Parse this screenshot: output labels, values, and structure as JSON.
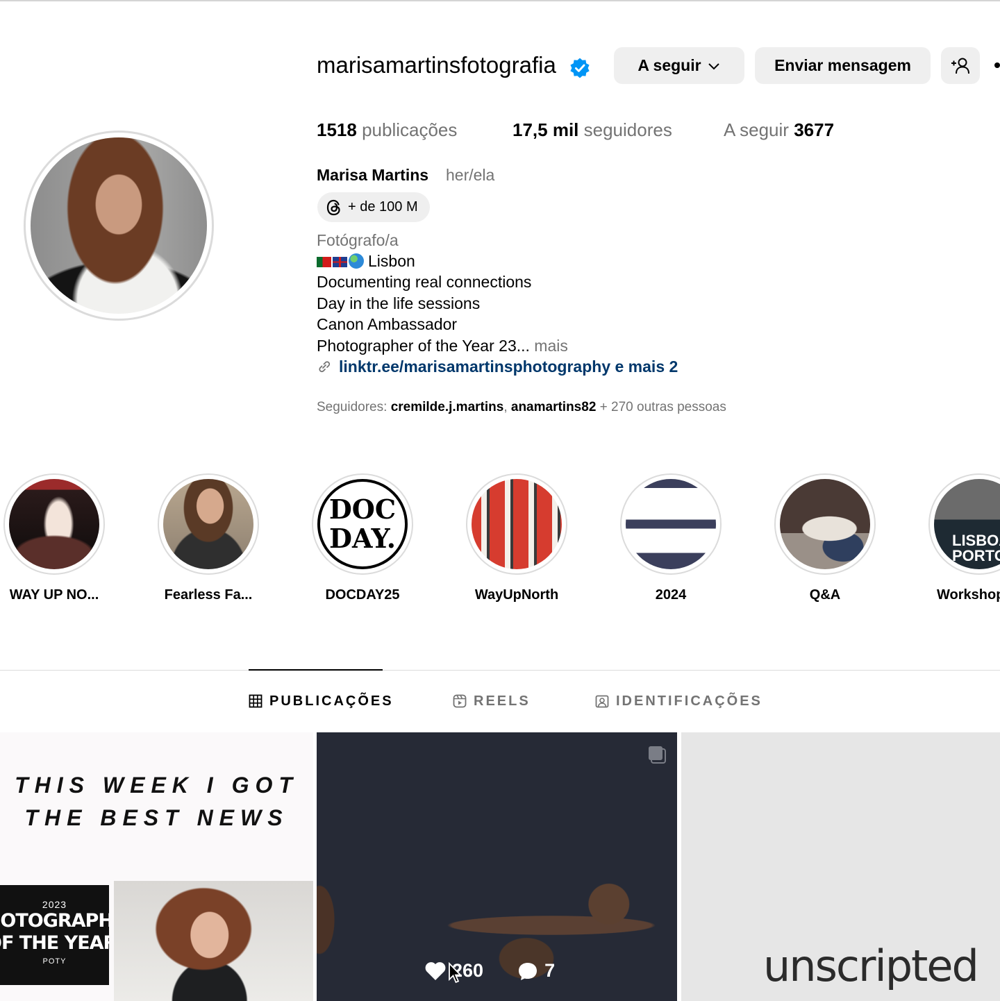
{
  "profile": {
    "username": "marisamartinsfotografia",
    "verified_icon": "verified-badge-icon",
    "buttons": {
      "following": "A seguir",
      "message": "Enviar mensagem"
    },
    "stats": {
      "posts_count": "1518",
      "posts_label": "publicações",
      "followers_count": "17,5 mil",
      "followers_label": "seguidores",
      "following_label": "A seguir",
      "following_count": "3677"
    },
    "full_name": "Marisa Martins",
    "pronouns": "her/ela",
    "threads_badge": "+ de 100 M",
    "category": "Fotógrafo/a",
    "bio_lines": [
      "Lisbon",
      "Documenting real connections",
      "Day in the life sessions",
      "Canon Ambassador",
      "Photographer of the Year 23..."
    ],
    "bio_more": "mais",
    "link": "linktr.ee/marisamartinsphotography e mais 2",
    "followed_by": {
      "prefix": "Seguidores:",
      "user1": "cremilde.j.martins",
      "separator": ",",
      "user2": "anamartins82",
      "suffix": "+ 270 outras pessoas"
    }
  },
  "highlights": [
    {
      "label": "WAY UP NO..."
    },
    {
      "label": "Fearless Fa..."
    },
    {
      "label": "DOCDAY25",
      "cover_line1": "DOC",
      "cover_line2": "DAY."
    },
    {
      "label": "WayUpNorth"
    },
    {
      "label": "2024"
    },
    {
      "label": "Q&A"
    },
    {
      "label": "Workshop",
      "cover_line1": "LISBOA",
      "cover_line2": "PORTO"
    }
  ],
  "tabs": [
    {
      "label": "PUBLICAÇÕES",
      "icon": "grid-icon",
      "active": true
    },
    {
      "label": "REELS",
      "icon": "reels-icon",
      "active": false
    },
    {
      "label": "IDENTIFICAÇÕES",
      "icon": "tagged-icon",
      "active": false
    }
  ],
  "posts": [
    {
      "text_line1": "THIS WEEK I GOT",
      "text_line2": "THE BEST NEWS",
      "poster_year": "2023",
      "poster_line1": "PHOTOGRAPHER",
      "poster_line2": "OF THE YEAR",
      "poster_tag": "POTY"
    },
    {
      "likes": "260",
      "comments": "7",
      "multi_icon": "carousel-icon"
    },
    {
      "text": "unscripted"
    }
  ],
  "colors": {
    "verified_blue": "#0095f6",
    "link_blue": "#00376b",
    "button_bg": "#efefef",
    "muted_text": "#737373"
  }
}
